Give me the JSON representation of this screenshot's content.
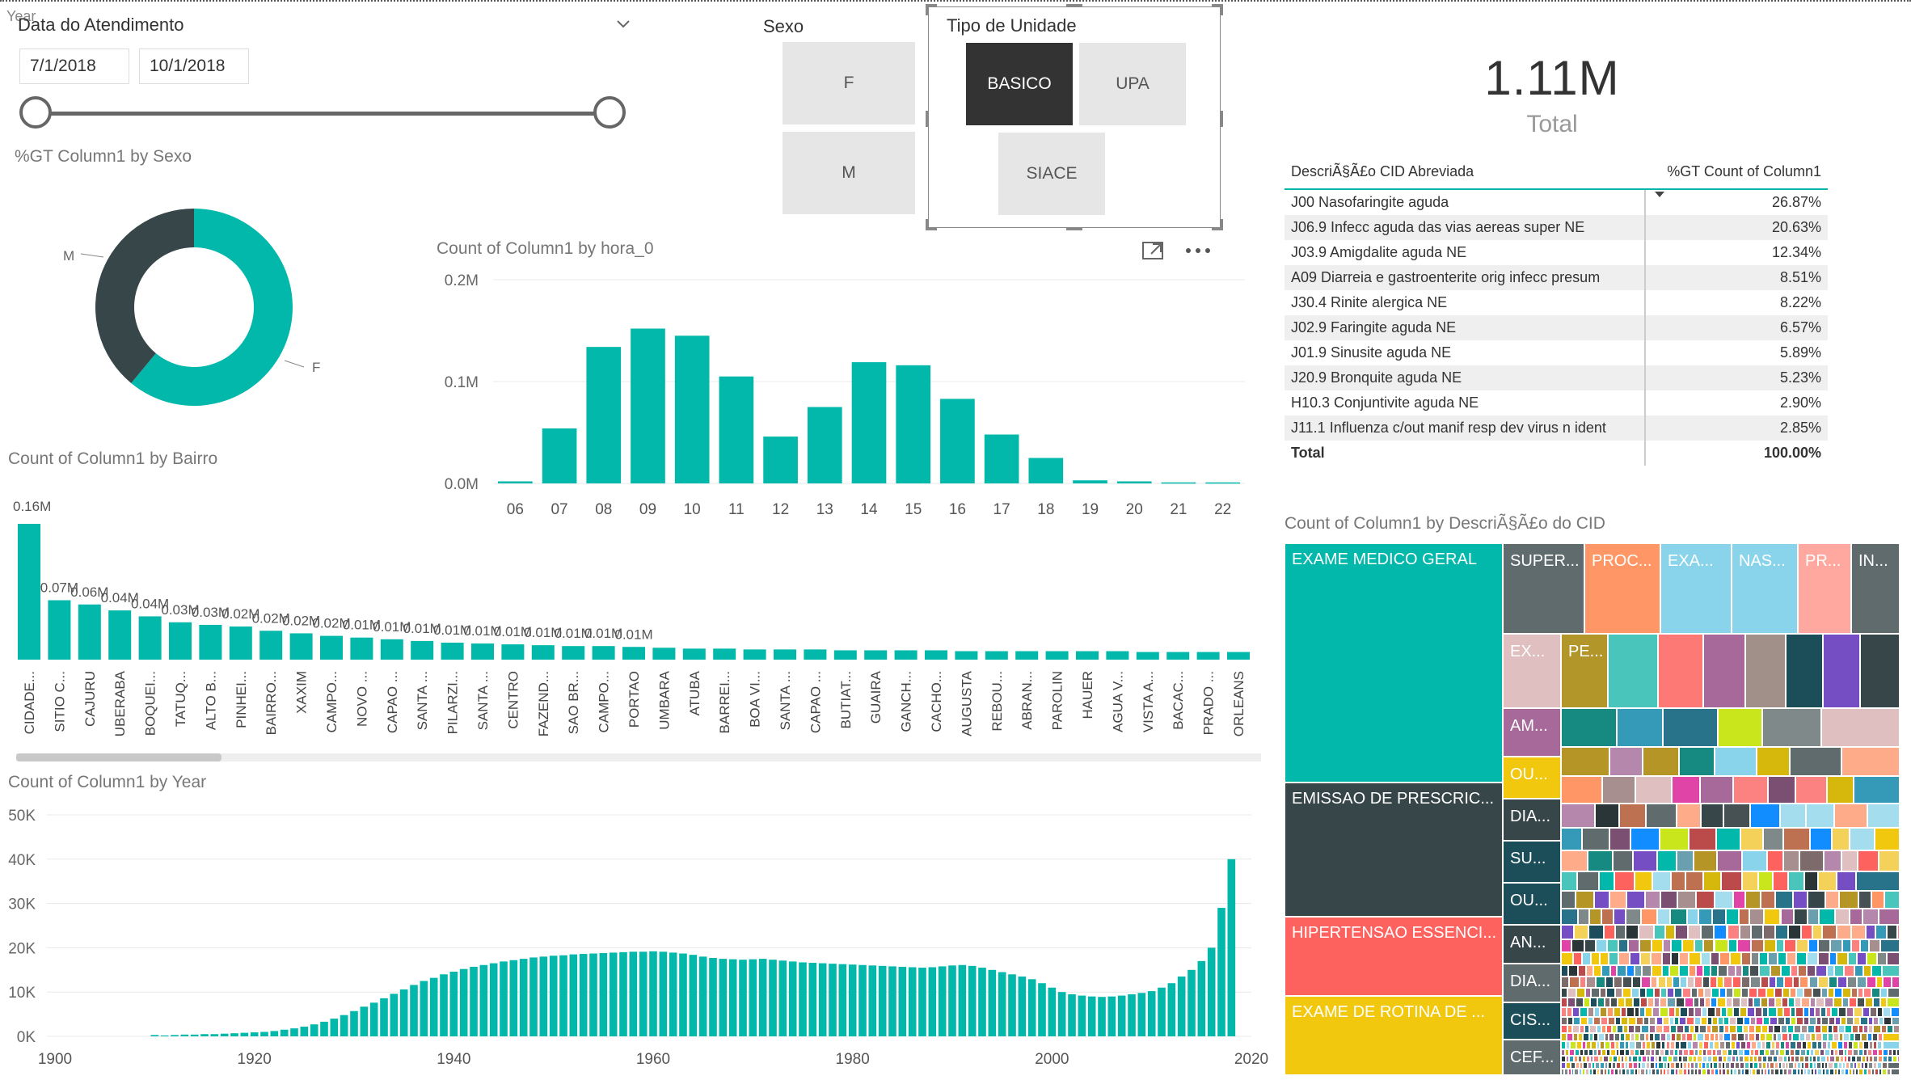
{
  "colors": {
    "teal": "#01b8aa",
    "dark": "#374649",
    "grid": "#e8e8e8"
  },
  "slicer_date": {
    "overlay_label": "Year",
    "title": "Data do Atendimento",
    "start": "7/1/2018",
    "end": "10/1/2018",
    "dropdown_icon": "chevron-down-icon"
  },
  "slicer_sexo": {
    "title": "Sexo",
    "options": [
      "F",
      "M"
    ]
  },
  "slicer_unidade": {
    "title": "Tipo de Unidade",
    "options": [
      "BASICO",
      "UPA",
      "SIACE"
    ],
    "selected": "BASICO"
  },
  "card": {
    "value": "1.11M",
    "label": "Total"
  },
  "donut": {
    "title": "%GT Column1 by Sexo",
    "labels": {
      "m": "M",
      "f": "F"
    },
    "chart_data": {
      "type": "pie",
      "categories": [
        "F",
        "M"
      ],
      "values": [
        0.61,
        0.39
      ]
    }
  },
  "hora_chart": {
    "title": "Count of Column1 by hora_0",
    "focus_icon": "focus-mode-icon",
    "more_icon": "more-options-icon",
    "yticks": [
      "0.2M",
      "0.1M",
      "0.0M"
    ],
    "chart_data": {
      "type": "bar",
      "categories": [
        "06",
        "07",
        "08",
        "09",
        "10",
        "11",
        "12",
        "13",
        "14",
        "15",
        "16",
        "17",
        "18",
        "19",
        "20",
        "21",
        "22"
      ],
      "values": [
        0.002,
        0.054,
        0.134,
        0.152,
        0.145,
        0.105,
        0.046,
        0.075,
        0.119,
        0.116,
        0.083,
        0.048,
        0.025,
        0.003,
        0.002,
        0.001,
        0.001
      ],
      "ylim": [
        0,
        0.2
      ]
    }
  },
  "bairro_chart": {
    "title": "Count of Column1 by Bairro",
    "chart_data": {
      "type": "bar",
      "categories": [
        "CIDADE...",
        "SITIO C...",
        "CAJURU",
        "UBERABA",
        "BOQUEI...",
        "TATUQ...",
        "ALTO B...",
        "PINHEI...",
        "BAIRRO...",
        "XAXIM",
        "CAMPO...",
        "NOVO ...",
        "CAPAO ...",
        "SANTA ...",
        "PILARZI...",
        "SANTA ...",
        "CENTRO",
        "FAZEND...",
        "SAO BR...",
        "CAMPO...",
        "PORTAO",
        "UMBARA",
        "ATUBA",
        "BARREI...",
        "BOA VI...",
        "SANTA ...",
        "CAPAO ...",
        "BUTIAT...",
        "GUAIRA",
        "GANCH...",
        "CACHO...",
        "AUGUSTA",
        "REBOU...",
        "ABRAN...",
        "PAROLIN",
        "HAUER",
        "AGUA V...",
        "VISTA A...",
        "BACAC...",
        "PRADO ...",
        "ORLEANS"
      ],
      "values": [
        0.16,
        0.07,
        0.065,
        0.058,
        0.051,
        0.044,
        0.041,
        0.039,
        0.034,
        0.031,
        0.028,
        0.026,
        0.024,
        0.022,
        0.02,
        0.019,
        0.018,
        0.017,
        0.016,
        0.016,
        0.015,
        0.014,
        0.013,
        0.013,
        0.012,
        0.012,
        0.012,
        0.011,
        0.011,
        0.011,
        0.011,
        0.01,
        0.01,
        0.01,
        0.01,
        0.01,
        0.01,
        0.009,
        0.009,
        0.009,
        0.009
      ],
      "data_labels": [
        "0.16M",
        "0.07M",
        "0.06M",
        "0.04M",
        "0.04M",
        "0.03M",
        "0.03M",
        "0.02M",
        "0.02M",
        "0.02M",
        "0.02M",
        "0.01M",
        "0.01M",
        "0.01M",
        "0.01M",
        "0.01M",
        "0.01M",
        "0.01M",
        "0.01M",
        "0.01M",
        "0.01M"
      ]
    }
  },
  "year_chart": {
    "title": "Count of Column1 by Year",
    "yticks": [
      "50K",
      "40K",
      "30K",
      "20K",
      "10K",
      "0K"
    ],
    "xticks": [
      "1900",
      "1920",
      "1940",
      "1960",
      "1980",
      "2000",
      "2020"
    ],
    "chart_data": {
      "type": "bar",
      "x": [
        1910,
        1911,
        1912,
        1913,
        1914,
        1915,
        1916,
        1917,
        1918,
        1919,
        1920,
        1921,
        1922,
        1923,
        1924,
        1925,
        1926,
        1927,
        1928,
        1929,
        1930,
        1931,
        1932,
        1933,
        1934,
        1935,
        1936,
        1937,
        1938,
        1939,
        1940,
        1941,
        1942,
        1943,
        1944,
        1945,
        1946,
        1947,
        1948,
        1949,
        1950,
        1951,
        1952,
        1953,
        1954,
        1955,
        1956,
        1957,
        1958,
        1959,
        1960,
        1961,
        1962,
        1963,
        1964,
        1965,
        1966,
        1967,
        1968,
        1969,
        1970,
        1971,
        1972,
        1973,
        1974,
        1975,
        1976,
        1977,
        1978,
        1979,
        1980,
        1981,
        1982,
        1983,
        1984,
        1985,
        1986,
        1987,
        1988,
        1989,
        1990,
        1991,
        1992,
        1993,
        1994,
        1995,
        1996,
        1997,
        1998,
        1999,
        2000,
        2001,
        2002,
        2003,
        2004,
        2005,
        2006,
        2007,
        2008,
        2009,
        2010,
        2011,
        2012,
        2013,
        2014,
        2015,
        2016,
        2017,
        2018
      ],
      "values": [
        300,
        200,
        300,
        400,
        400,
        500,
        500,
        600,
        700,
        800,
        900,
        1000,
        1200,
        1500,
        1800,
        2200,
        2700,
        3300,
        4000,
        4800,
        5700,
        6700,
        7600,
        8600,
        9600,
        10600,
        11600,
        12500,
        13200,
        14000,
        14600,
        15200,
        15700,
        16100,
        16500,
        16900,
        17200,
        17500,
        17800,
        18000,
        18200,
        18300,
        18500,
        18600,
        18700,
        18800,
        18900,
        19000,
        19100,
        19100,
        19200,
        19100,
        18900,
        18700,
        18400,
        18000,
        17700,
        17500,
        17400,
        17300,
        17400,
        17500,
        17300,
        17100,
        16900,
        16700,
        16600,
        16500,
        16400,
        16300,
        16200,
        16100,
        16000,
        15900,
        15800,
        15700,
        15600,
        15500,
        15600,
        15800,
        16000,
        16100,
        15900,
        15500,
        15000,
        14500,
        14000,
        13500,
        12900,
        12000,
        11000,
        10000,
        9500,
        9200,
        9000,
        8900,
        9000,
        9200,
        9500,
        9800,
        10200,
        11000,
        12000,
        13500,
        15000,
        17000,
        20000,
        29000,
        40000
      ],
      "xlim": [
        1900,
        2020
      ],
      "ylim": [
        0,
        50000
      ]
    }
  },
  "cid_table": {
    "headers": [
      "DescriÃ§Ã£o CID Abreviada",
      "%GT Count of Column1"
    ],
    "rows": [
      [
        "J00 Nasofaringite aguda",
        "26.87%"
      ],
      [
        "J06.9 Infecc aguda das vias aereas super NE",
        "20.63%"
      ],
      [
        "J03.9 Amigdalite aguda NE",
        "12.34%"
      ],
      [
        "A09 Diarreia e gastroenterite orig infecc presum",
        "8.51%"
      ],
      [
        "J30.4 Rinite alergica NE",
        "8.22%"
      ],
      [
        "J02.9 Faringite aguda NE",
        "6.57%"
      ],
      [
        "J01.9 Sinusite aguda NE",
        "5.89%"
      ],
      [
        "J20.9 Bronquite aguda NE",
        "5.23%"
      ],
      [
        "H10.3 Conjuntivite aguda NE",
        "2.90%"
      ],
      [
        "J11.1 Influenza c/out manif resp dev virus n ident",
        "2.85%"
      ]
    ],
    "total_label": "Total",
    "total_value": "100.00%"
  },
  "treemap": {
    "title": "Count of Column1 by DescriÃ§Ã£o do CID",
    "labels": [
      "EXAME MEDICO GERAL",
      "EMISSAO DE PRESCRIC...",
      "HIPERTENSAO ESSENCI...",
      "EXAME DE ROTINA DE ...",
      "SUPER...",
      "PROC...",
      "EXA...",
      "NAS...",
      "PR...",
      "IN...",
      "EX...",
      "PE...",
      "AM...",
      "OU...",
      "DIA...",
      "SU...",
      "OU...",
      "AN...",
      "DIA...",
      "CIS...",
      "CEF..."
    ]
  }
}
